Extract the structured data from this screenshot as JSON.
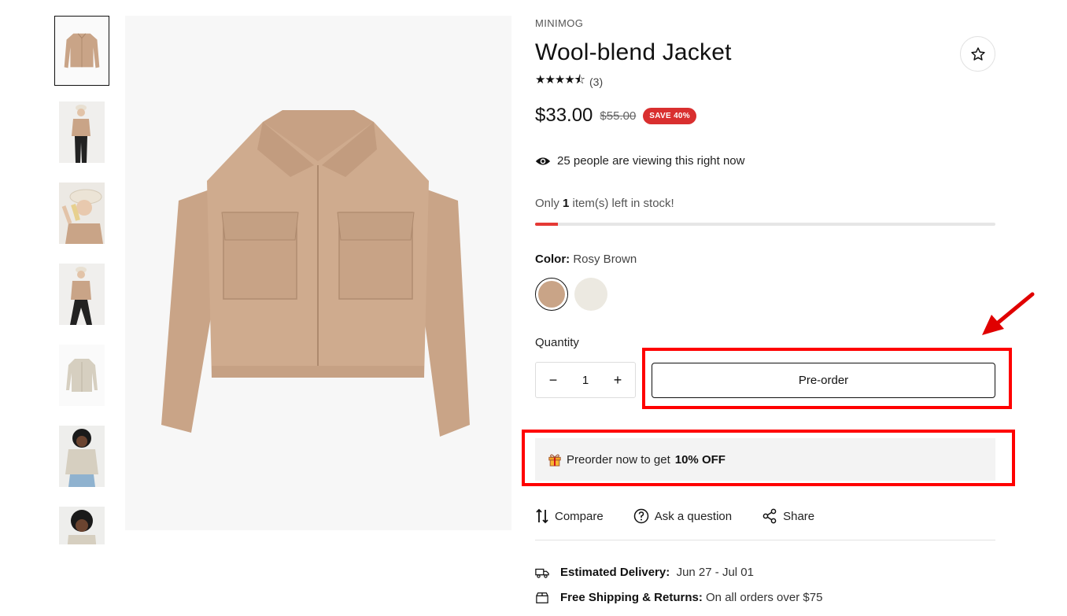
{
  "product": {
    "vendor": "MINIMOG",
    "title": "Wool-blend Jacket",
    "rating_stars": "★★★★⯪",
    "rating_value": 4.5,
    "rating_count": "(3)",
    "price": "$33.00",
    "compare_price": "$55.00",
    "sale_badge": "SAVE 40%"
  },
  "viewers": {
    "text": "25 people are viewing this right now",
    "icon": "eye-icon"
  },
  "stock": {
    "prefix": "Only",
    "count": "1",
    "suffix": "item(s) left in stock!",
    "fill_fraction": 0.05,
    "bar_color": "#e53935"
  },
  "color": {
    "label": "Color:",
    "selected": "Rosy Brown",
    "swatches": [
      {
        "name": "Rosy Brown",
        "hex": "#c9a487"
      },
      {
        "name": "Ivory",
        "hex": "#ece9e1"
      }
    ]
  },
  "quantity": {
    "label": "Quantity",
    "minus": "−",
    "value": "1",
    "plus": "+"
  },
  "preorder": {
    "button_label": "Pre-order"
  },
  "promo": {
    "text": "Preorder now to get",
    "highlight": "10% OFF",
    "icon": "gift-icon"
  },
  "actions": [
    {
      "label": "Compare",
      "icon": "compare-icon"
    },
    {
      "label": "Ask a question",
      "icon": "question-icon"
    },
    {
      "label": "Share",
      "icon": "share-icon"
    }
  ],
  "delivery": {
    "label": "Estimated Delivery:",
    "value": "Jun 27 - Jul 01",
    "icon": "truck-icon"
  },
  "shipping": {
    "label": "Free Shipping & Returns:",
    "value": "On all orders over $75",
    "icon": "box-icon"
  },
  "colors": {
    "annotation": "#ff0000",
    "sale": "#d92f2f",
    "jacket": "#c9a487"
  }
}
